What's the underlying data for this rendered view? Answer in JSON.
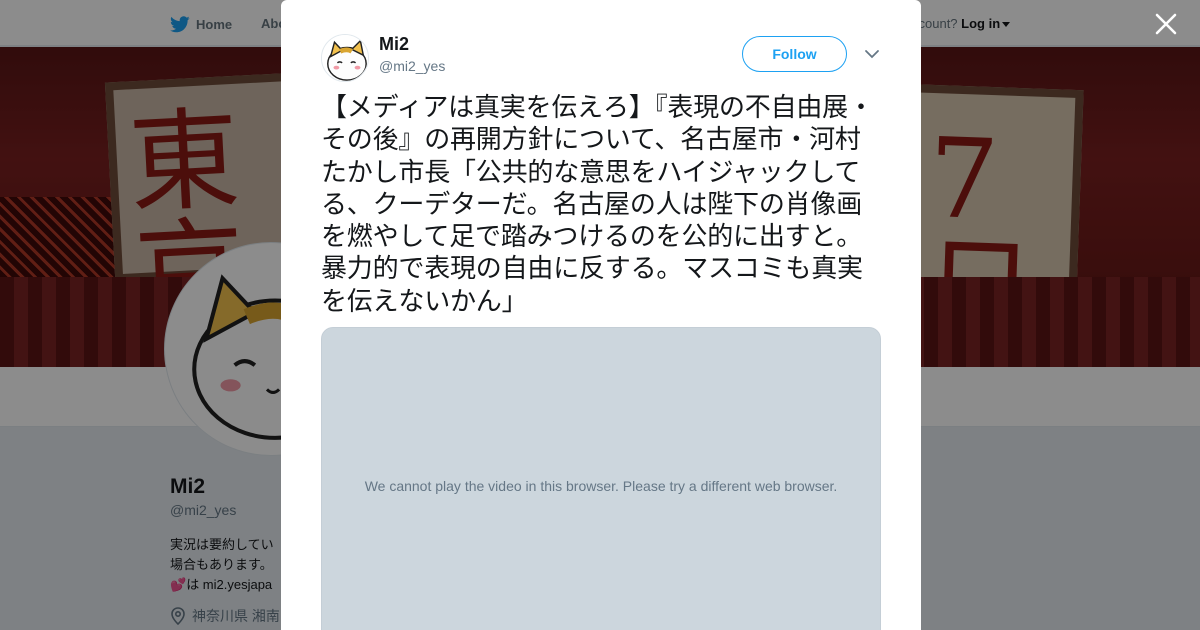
{
  "nav": {
    "home_label": "Home",
    "about_label": "Abo",
    "account_prompt": "ccount?",
    "login_label": "Log in"
  },
  "banner": {
    "left_sign_text": "東京",
    "right_sign_text": "7日"
  },
  "profile": {
    "name": "Mi2",
    "handle": "@mi2_yes",
    "bio_line1": "実況は要約してい",
    "bio_line2": "場合もあります。",
    "bio_line3": "は mi2.yesjapa",
    "location": "神奈川県 湘南"
  },
  "tweet": {
    "author_name": "Mi2",
    "author_handle": "@mi2_yes",
    "follow_label": "Follow",
    "text": "【メディアは真実を伝えろ】『表現の不自由展・その後』の再開方針について、名古屋市・河村たかし市長「公共的な意思をハイジャックしてる、クーデターだ。名古屋の人は陛下の肖像画を燃やして足で踏みつけるのを公的に出すと。暴力的で表現の自由に反する。マスコミも真実を伝えないかん」",
    "video_message": "We cannot play the video in this browser. Please try a different web browser."
  },
  "colors": {
    "accent": "#1da1f2",
    "overlay": "rgba(0,0,0,0.45)",
    "video_bg": "#ccd6dd"
  },
  "icons": {
    "nav_logo": "twitter-bird-icon",
    "close": "close-icon",
    "more": "chevron-down-icon",
    "location": "location-pin-icon"
  }
}
